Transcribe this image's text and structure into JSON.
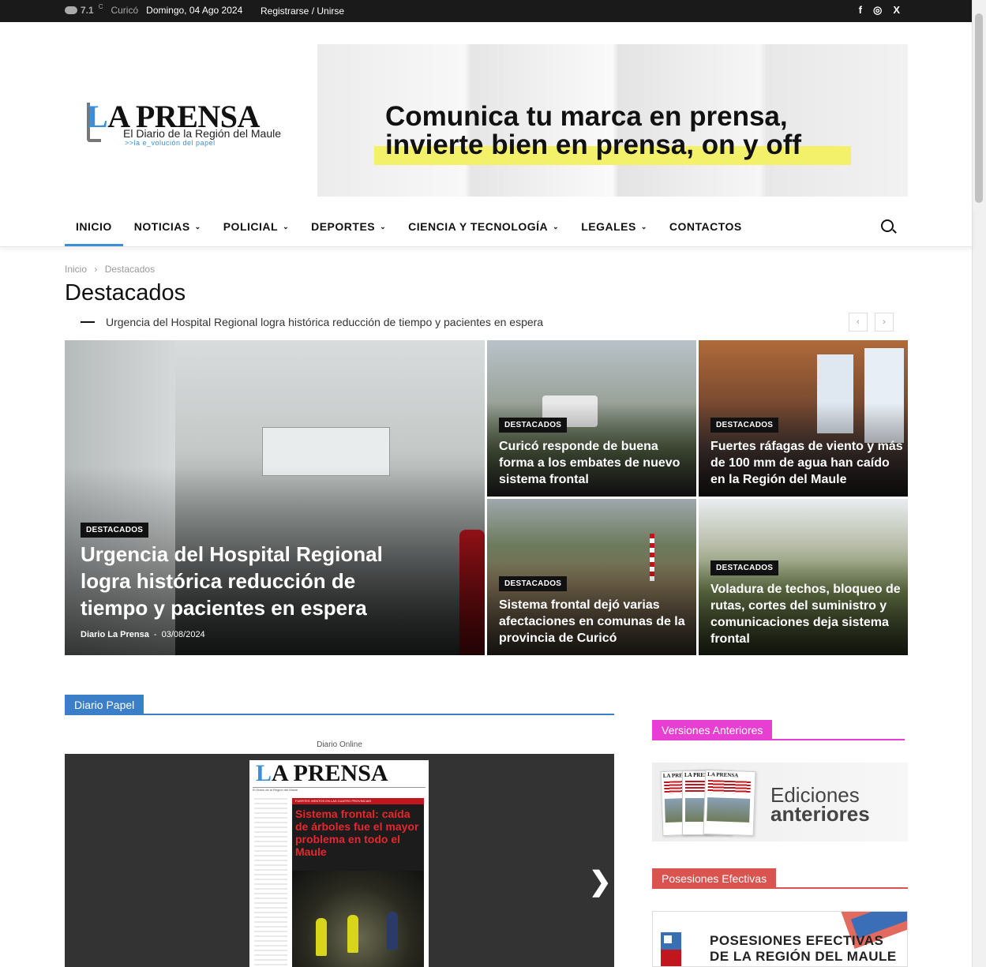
{
  "topbar": {
    "temperature": "7.1",
    "unit": "C",
    "city": "Curicó",
    "date": "Domingo, 04 Ago 2024",
    "register": "Registrarse / Unirse",
    "social": [
      "f",
      "◎",
      "X"
    ]
  },
  "logo": {
    "name_first_letter": "L",
    "name_rest": "A PRENSA",
    "subtitle": "El Diario de la Región del Maule",
    "tagline": ">>la e_volución del papel"
  },
  "banner": {
    "line1": "Comunica tu marca en prensa,",
    "line2_normal": "invierte bien en prensa, ",
    "line2_bold": "on y off"
  },
  "nav": {
    "items": [
      {
        "label": "INICIO"
      },
      {
        "label": "NOTICIAS",
        "dropdown": "⌄"
      },
      {
        "label": "POLICIAL",
        "dropdown": "⌄"
      },
      {
        "label": "DEPORTES",
        "dropdown": "⌄"
      },
      {
        "label": "CIENCIA Y TECNOLOGÍA",
        "dropdown": "⌄"
      },
      {
        "label": "LEGALES",
        "dropdown": "⌄"
      },
      {
        "label": "CONTACTOS"
      }
    ]
  },
  "breadcrumb": {
    "home": "Inicio",
    "sep": "›",
    "current": "Destacados"
  },
  "page_title": "Destacados",
  "ticker": {
    "text": "Urgencia del Hospital Regional logra histórica reducción de tiempo y pacientes en espera",
    "prev": "‹",
    "next": "›"
  },
  "featured": {
    "main": {
      "category": "DESTACADOS",
      "title": "Urgencia del Hospital Regional logra histórica reducción de tiempo y pacientes en espera",
      "author": "Diario La Prensa",
      "sep": "-",
      "date": "03/08/2024"
    },
    "grid": [
      {
        "category": "DESTACADOS",
        "title": "Curicó responde de buena forma a los embates de nuevo sistema frontal"
      },
      {
        "category": "DESTACADOS",
        "title": "Fuertes ráfagas de viento y más de 100 mm de agua han caído en la Región del Maule"
      },
      {
        "category": "DESTACADOS",
        "title": "Sistema frontal dejó varias afectaciones en comunas de la provincia de Curicó"
      },
      {
        "category": "DESTACADOS",
        "title": "Voladura de techos, bloqueo de rutas, cortes del suministro y comunicaciones deja sistema frontal"
      }
    ]
  },
  "diario_papel": {
    "header": "Diario Papel",
    "caption": "Diario Online",
    "cover_title_first": "L",
    "cover_title_rest": "A PRENSA",
    "cover_strip": "El Diario de la Región del Maule",
    "cover_section": "FUERTES VIENTOS EN LAS CUATRO PROVINCIAS",
    "cover_headline": "Sistema frontal: caída de árboles fue el mayor problema en todo el Maule",
    "next": "❯"
  },
  "sidebar": {
    "versiones": {
      "header": "Versiones Anteriores",
      "thumb_title": "LA PRENSA",
      "line1": "Ediciones",
      "line2": "anteriores"
    },
    "posesiones": {
      "header": "Posesiones Efectivas",
      "line1": "POSESIONES EFECTIVAS",
      "line2": "DE LA REGIÓN DEL MAULE"
    }
  },
  "colors": {
    "accent_blue": "#3a8fd8",
    "section_blue": "#3a7fc8",
    "magenta": "#e63fd2",
    "coral": "#d9534f",
    "topbar": "#1a1a1a"
  }
}
